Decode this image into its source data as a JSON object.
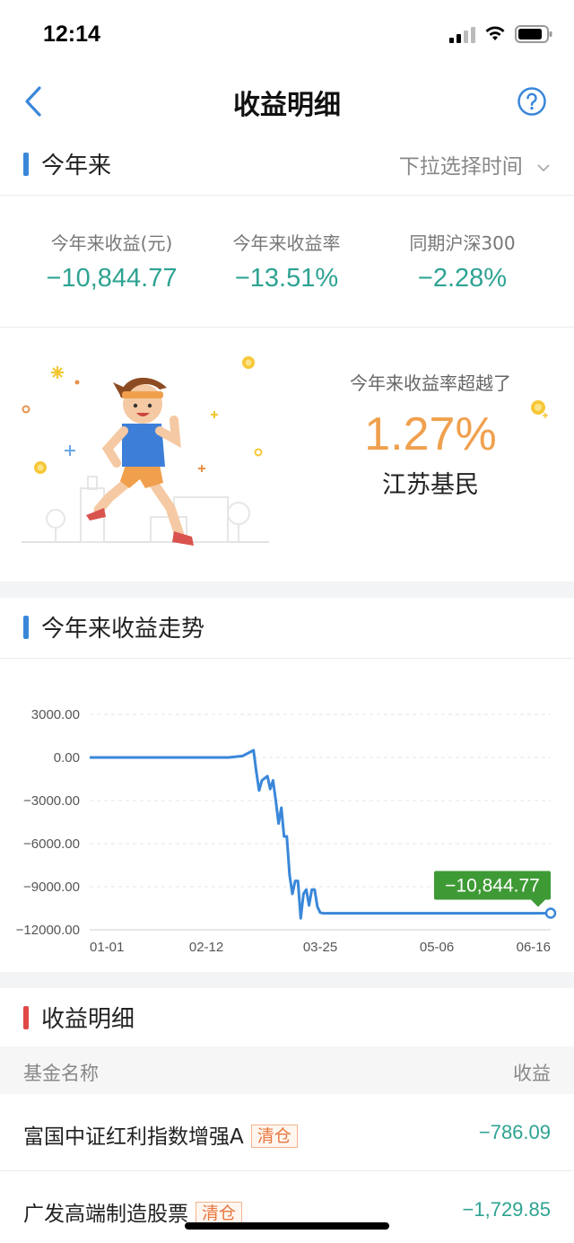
{
  "status_bar": {
    "time": "12:14"
  },
  "nav": {
    "title": "收益明细"
  },
  "period_section": {
    "title": "今年来",
    "time_select": "下拉选择时间"
  },
  "stats": [
    {
      "label": "今年来收益(元)",
      "value": "−10,844.77"
    },
    {
      "label": "今年来收益率",
      "value": "−13.51%"
    },
    {
      "label": "同期沪深300",
      "value": "−2.28%"
    }
  ],
  "rank": {
    "label": "今年来收益率超越了",
    "percent": "1.27%",
    "group": "江苏基民"
  },
  "trend_section": {
    "title": "今年来收益走势"
  },
  "chart_data": {
    "type": "line",
    "title": "",
    "xlabel": "",
    "ylabel": "",
    "y_ticks": [
      "3000.00",
      "0.00",
      "−3000.00",
      "−6000.00",
      "−9000.00",
      "−12000.00"
    ],
    "x_ticks": [
      "01-01",
      "02-12",
      "03-25",
      "05-06",
      "06-16"
    ],
    "ylim": [
      -12000,
      3000
    ],
    "grid": true,
    "color": "#3a87d9",
    "tooltip": "−10,844.77",
    "tooltip_color": "#3e9a35",
    "series": [
      {
        "x": [
          "01-01",
          "01-10",
          "01-20",
          "02-01",
          "02-10",
          "02-20",
          "02-25",
          "03-01",
          "03-02",
          "03-03",
          "03-04",
          "03-06",
          "03-07",
          "03-08",
          "03-09",
          "03-10",
          "03-11",
          "03-12",
          "03-13",
          "03-14",
          "03-15",
          "03-16",
          "03-17",
          "03-18",
          "03-19",
          "03-20",
          "03-21",
          "03-22",
          "03-23",
          "03-24",
          "03-25",
          "03-26",
          "03-27",
          "03-28",
          "03-29",
          "03-30",
          "04-01",
          "04-10",
          "04-20",
          "05-01",
          "05-10",
          "05-20",
          "06-01",
          "06-10",
          "06-16"
        ],
        "y": [
          0,
          0,
          0,
          0,
          0,
          0,
          100,
          500,
          -1000,
          -2300,
          -1600,
          -1300,
          -2200,
          -1600,
          -3000,
          -4600,
          -3500,
          -5500,
          -5500,
          -8200,
          -9500,
          -8600,
          -8600,
          -11200,
          -9500,
          -9200,
          -10300,
          -9200,
          -9200,
          -10400,
          -10800,
          -10850,
          -10850,
          -10850,
          -10850,
          -10850,
          -10850,
          -10850,
          -10850,
          -10850,
          -10850,
          -10850,
          -10850,
          -10850,
          -10844.77
        ]
      }
    ]
  },
  "detail_section": {
    "title": "收益明细",
    "col_name": "基金名称",
    "col_value": "收益"
  },
  "funds": [
    {
      "name": "富国中证红利指数增强A",
      "tag": "清仓",
      "value": "−786.09"
    },
    {
      "name": "广发高端制造股票",
      "tag": "清仓",
      "value": "−1,729.85"
    }
  ],
  "colors": {
    "accent_blue": "#3a87d9",
    "gain_green": "#2ea392",
    "rank_orange": "#f0a04d",
    "detail_bar_red": "#e04848",
    "tooltip_green": "#3e9a35"
  },
  "icons": {
    "back": "chevron-left-icon",
    "help": "question-circle-icon",
    "dropdown": "chevron-down-icon"
  }
}
